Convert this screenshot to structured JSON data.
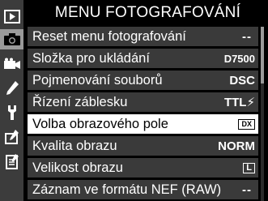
{
  "header": {
    "title": "MENU FOTOGRAFOVÁNÍ"
  },
  "tabs": [
    {
      "icon": "playback-icon"
    },
    {
      "icon": "camera-icon",
      "active": true
    },
    {
      "icon": "movie-icon"
    },
    {
      "icon": "pencil-icon"
    },
    {
      "icon": "wrench-icon"
    },
    {
      "icon": "retouch-icon"
    },
    {
      "icon": "my-menu-icon"
    }
  ],
  "menu": {
    "items": [
      {
        "label": "Reset menu fotografování",
        "value": "--"
      },
      {
        "label": "Složka pro ukládání",
        "value": "D7500"
      },
      {
        "label": "Pojmenování souborů",
        "value": "DSC"
      },
      {
        "label": "Řízení záblesku",
        "value": "TTL⚡"
      },
      {
        "label": "Volba obrazového pole",
        "value": "DX",
        "selected": true
      },
      {
        "label": "Kvalita obrazu",
        "value": "NORM"
      },
      {
        "label": "Velikost obrazu",
        "value": "L"
      },
      {
        "label": "Záznam ve formátu NEF (RAW)",
        "value": "--"
      }
    ]
  },
  "colors": {
    "row_bg": "#3a3a3a",
    "selected_bg": "#ffffff",
    "tab_bg": "#3c3c3c",
    "tab_active": "#9a9a9a"
  }
}
